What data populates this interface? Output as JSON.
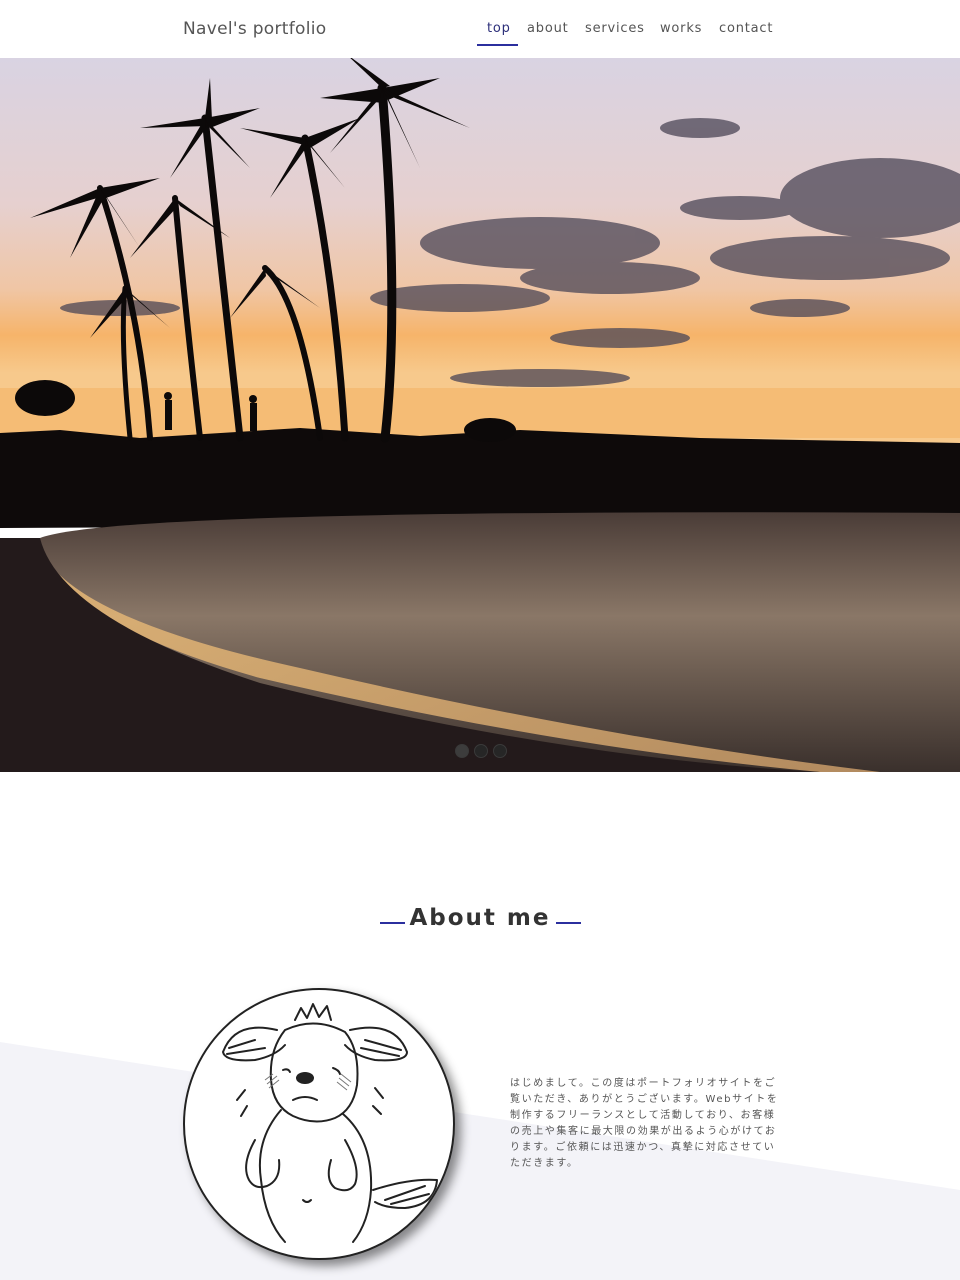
{
  "header": {
    "logo": "Navel's portfolio",
    "nav": [
      {
        "label": "top",
        "active": true
      },
      {
        "label": "about",
        "active": false
      },
      {
        "label": "services",
        "active": false
      },
      {
        "label": "works",
        "active": false
      },
      {
        "label": "contact",
        "active": false
      }
    ]
  },
  "hero": {
    "image": "sunset-beach-palm-trees-photo",
    "slide_count": 3,
    "active_slide": 1
  },
  "about": {
    "title": "About me",
    "avatar": "dog-character-sketch",
    "intro": "はじめまして。この度はポートフォリオサイトをご覧いただき、ありがとうございます。Webサイトを制作するフリーランスとして活動しており、お客様の売上や集客に最大限の効果が出るよう心がけております。ご依頼には迅速かつ、真摯に対応させていただきます。"
  },
  "colors": {
    "accent": "#2b2f9e",
    "slant_background": "#f3f3f8"
  }
}
